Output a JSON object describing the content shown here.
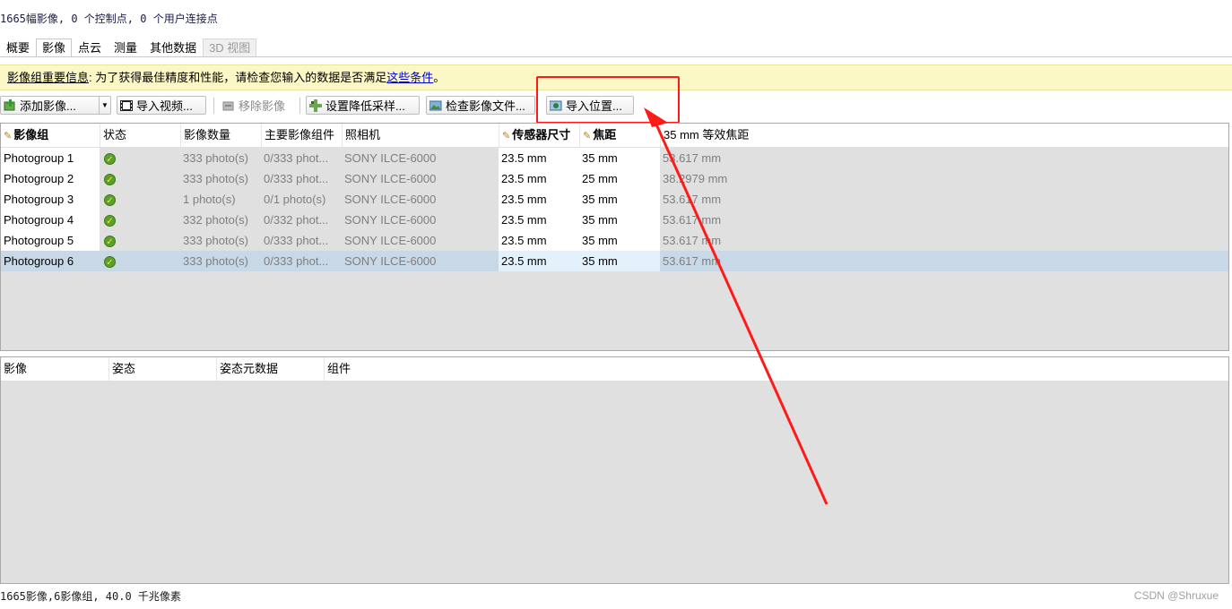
{
  "summary_text": "1665幅影像, 0 个控制点, 0 个用户连接点",
  "tabs": [
    {
      "label": "概要"
    },
    {
      "label": "影像"
    },
    {
      "label": "点云"
    },
    {
      "label": "测量"
    },
    {
      "label": "其他数据"
    },
    {
      "label": "3D 视图"
    }
  ],
  "info_bar": {
    "title": "影像组重要信息",
    "text": ": 为了获得最佳精度和性能，请检查您输入的数据是否满足",
    "link": "这些条件",
    "suffix": "。"
  },
  "toolbar": {
    "add_photos": "添加影像...",
    "import_video": "导入视频...",
    "remove_photos": "移除影像",
    "set_downsampling": "设置降低采样...",
    "check_image_files": "检查影像文件...",
    "import_positions": "导入位置..."
  },
  "photogroups_table": {
    "columns": [
      "影像组",
      "状态",
      "影像数量",
      "主要影像组件",
      "照相机",
      "传感器尺寸",
      "焦距",
      "35 mm 等效焦距"
    ],
    "rows": [
      {
        "name": "Photogroup 1",
        "count": "333 photo(s)",
        "main": "0/333 phot...",
        "camera": "SONY ILCE-6000",
        "sensor": "23.5 mm",
        "focal": "35 mm",
        "eq35": "53.617 mm"
      },
      {
        "name": "Photogroup 2",
        "count": "333 photo(s)",
        "main": "0/333 phot...",
        "camera": "SONY ILCE-6000",
        "sensor": "23.5 mm",
        "focal": "25 mm",
        "eq35": "38.2979 mm"
      },
      {
        "name": "Photogroup 3",
        "count": "1 photo(s)",
        "main": "0/1 photo(s)",
        "camera": "SONY ILCE-6000",
        "sensor": "23.5 mm",
        "focal": "35 mm",
        "eq35": "53.617 mm"
      },
      {
        "name": "Photogroup 4",
        "count": "332 photo(s)",
        "main": "0/332 phot...",
        "camera": "SONY ILCE-6000",
        "sensor": "23.5 mm",
        "focal": "35 mm",
        "eq35": "53.617 mm"
      },
      {
        "name": "Photogroup 5",
        "count": "333 photo(s)",
        "main": "0/333 phot...",
        "camera": "SONY ILCE-6000",
        "sensor": "23.5 mm",
        "focal": "35 mm",
        "eq35": "53.617 mm"
      },
      {
        "name": "Photogroup 6",
        "count": "333 photo(s)",
        "main": "0/333 phot...",
        "camera": "SONY ILCE-6000",
        "sensor": "23.5 mm",
        "focal": "35 mm",
        "eq35": "53.617 mm"
      }
    ]
  },
  "photos_table": {
    "columns": [
      "影像",
      "姿态",
      "姿态元数据",
      "组件"
    ]
  },
  "status_bar": "1665影像,6影像组, 40.0 千兆像素",
  "watermark": "CSDN @Shruxue",
  "colors": {
    "info_bg": "#fcf8c6",
    "highlight": "#ff1a1a",
    "selected_row": "#c9d8e6"
  }
}
